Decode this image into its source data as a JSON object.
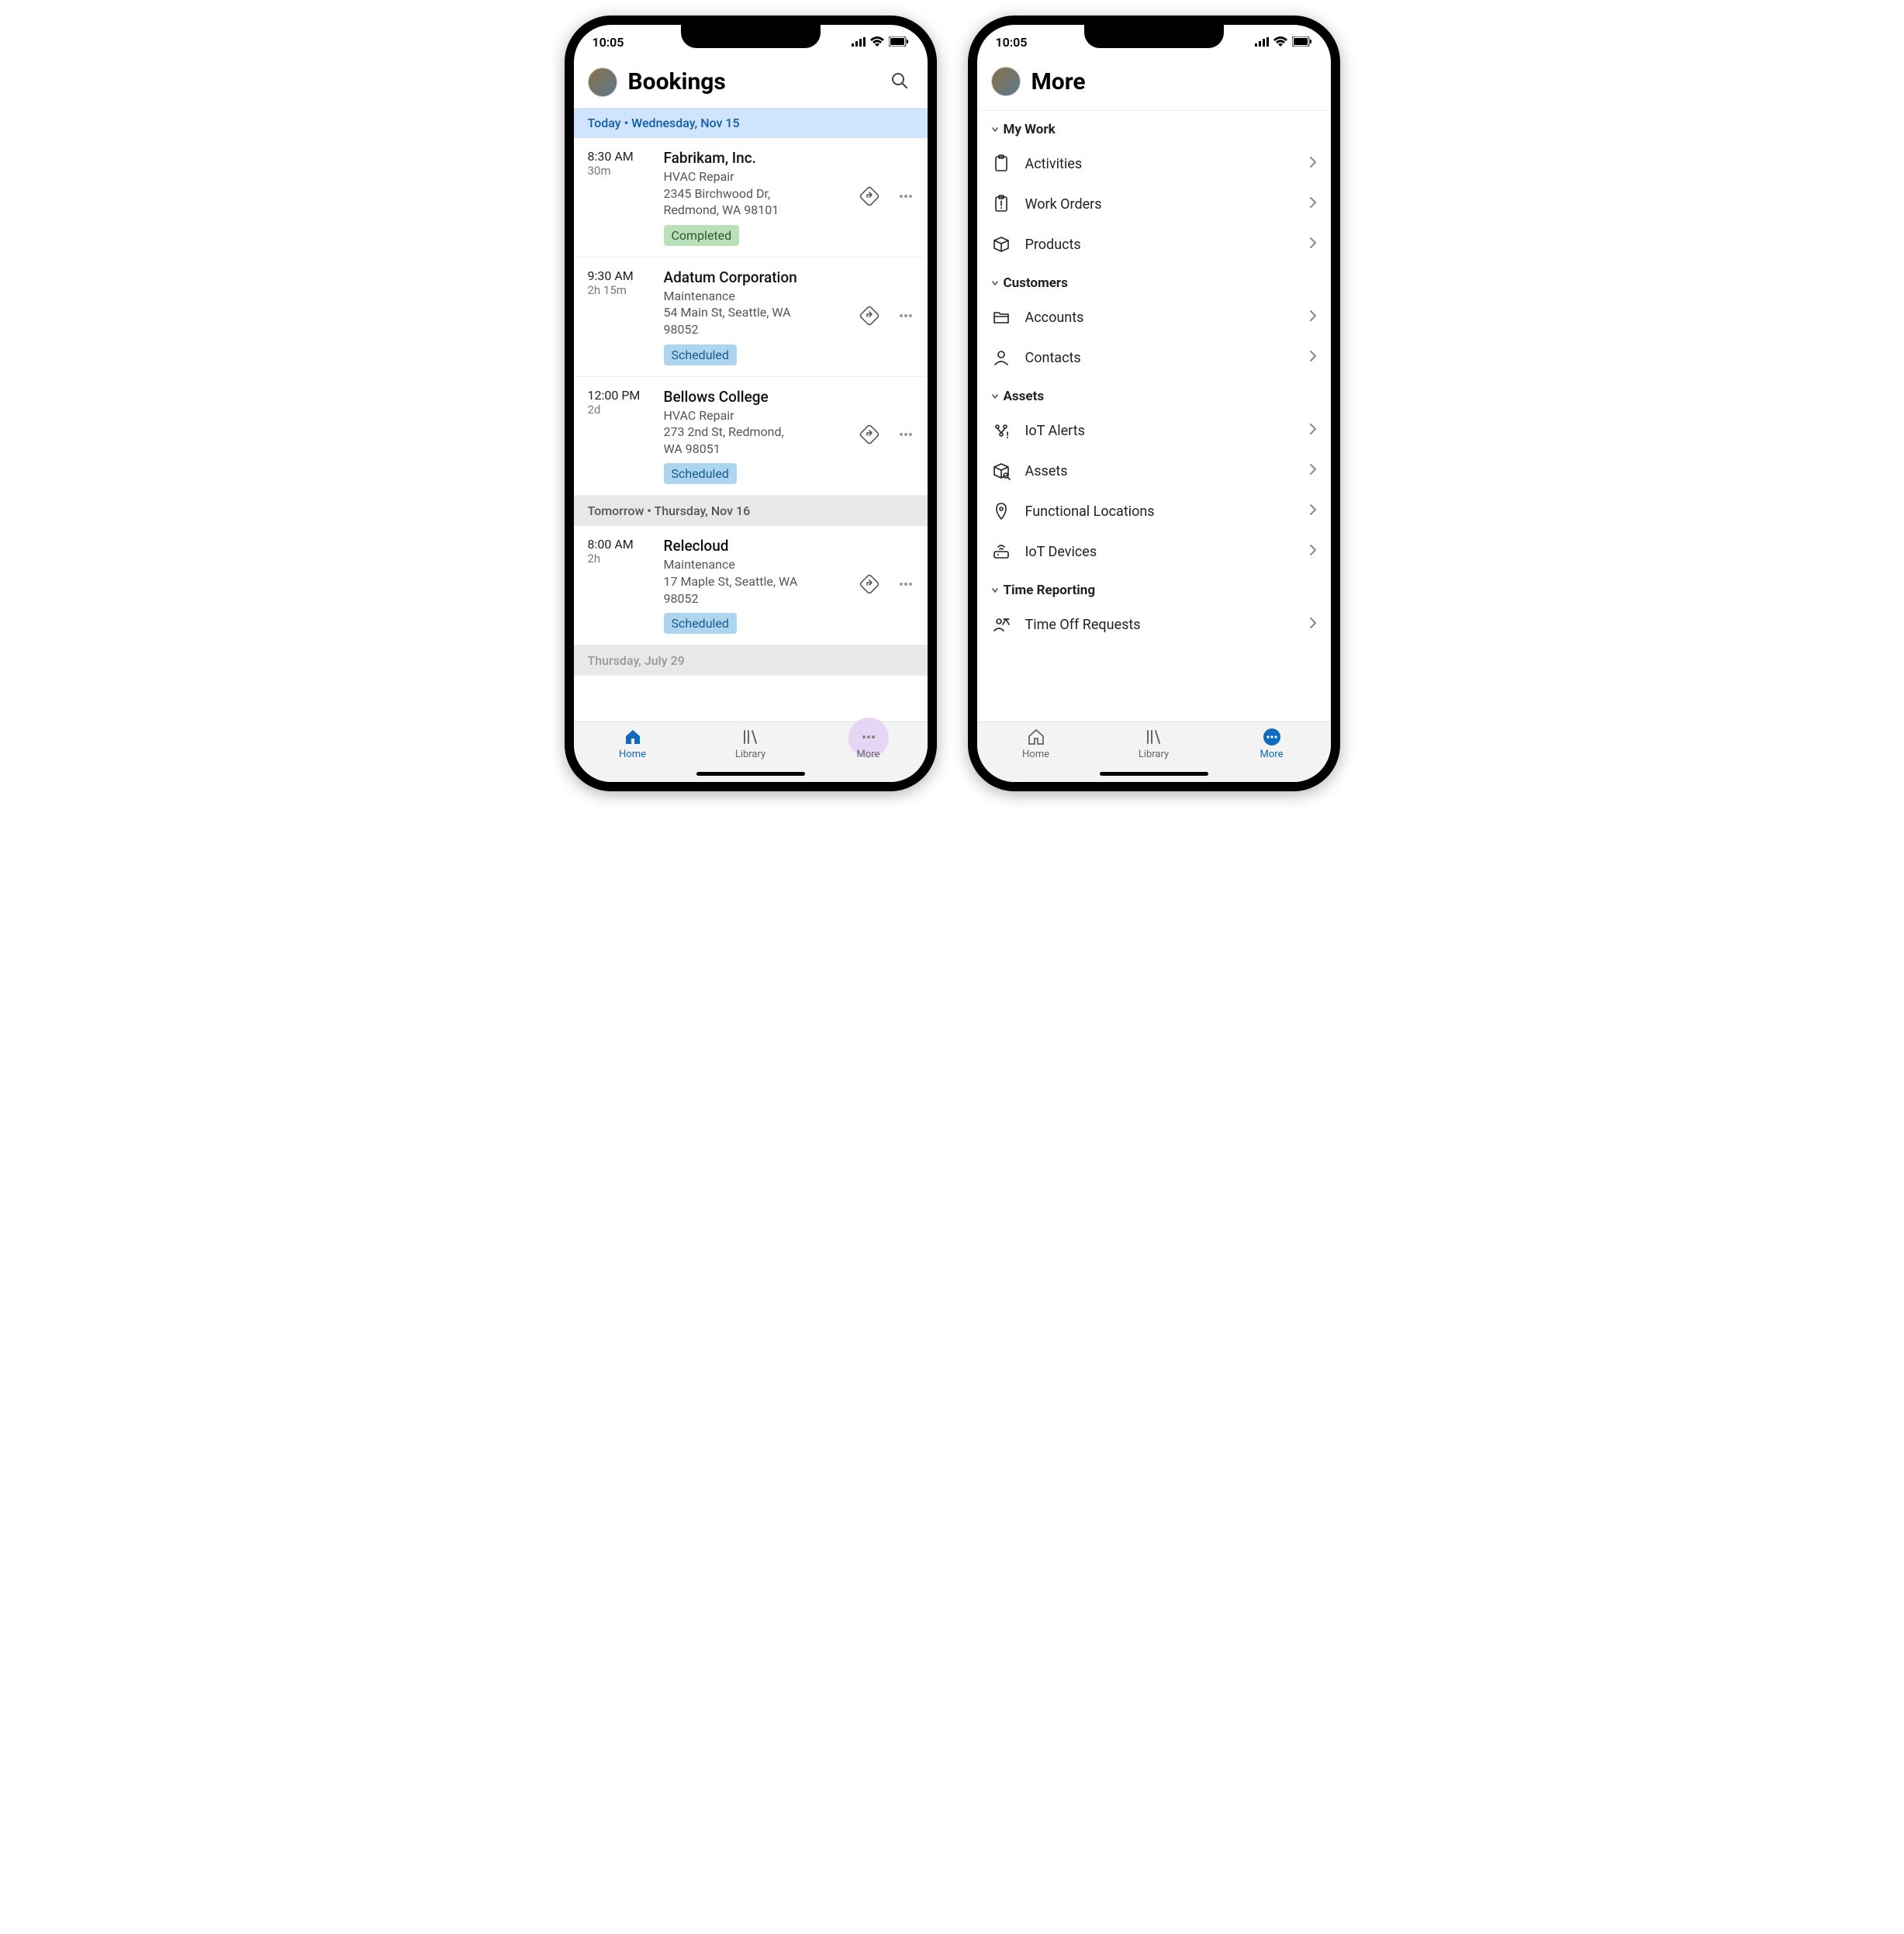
{
  "status": {
    "time": "10:05"
  },
  "left": {
    "title": "Bookings",
    "sections": [
      {
        "label": "Today  •  Wednesday, Nov 15",
        "kind": "today",
        "items": [
          {
            "time": "8:30 AM",
            "duration": "30m",
            "company": "Fabrikam, Inc.",
            "type": "HVAC Repair",
            "addr1": "2345 Birchwood Dr,",
            "addr2": "Redmond, WA 98101",
            "status": "Completed",
            "statusKind": "completed"
          },
          {
            "time": "9:30 AM",
            "duration": "2h 15m",
            "company": "Adatum Corporation",
            "type": "Maintenance",
            "addr1": "54 Main St, Seattle, WA",
            "addr2": "98052",
            "status": "Scheduled",
            "statusKind": "scheduled"
          },
          {
            "time": "12:00 PM",
            "duration": "2d",
            "company": "Bellows College",
            "type": "HVAC Repair",
            "addr1": "273 2nd St, Redmond,",
            "addr2": "WA 98051",
            "status": "Scheduled",
            "statusKind": "scheduled"
          }
        ]
      },
      {
        "label": "Tomorrow  •  Thursday, Nov 16",
        "kind": "tomorrow",
        "items": [
          {
            "time": "8:00 AM",
            "duration": "2h",
            "company": "Relecloud",
            "type": "Maintenance",
            "addr1": "17 Maple St, Seattle, WA",
            "addr2": "98052",
            "status": "Scheduled",
            "statusKind": "scheduled"
          }
        ]
      }
    ],
    "peekDate": "Thursday, July 29",
    "tabs": {
      "home": "Home",
      "library": "Library",
      "more": "More",
      "active": "home"
    }
  },
  "right": {
    "title": "More",
    "groups": [
      {
        "title": "My Work",
        "items": [
          {
            "icon": "clipboard",
            "label": "Activities"
          },
          {
            "icon": "clipboard-alert",
            "label": "Work Orders"
          },
          {
            "icon": "box",
            "label": "Products"
          }
        ]
      },
      {
        "title": "Customers",
        "items": [
          {
            "icon": "folder",
            "label": "Accounts"
          },
          {
            "icon": "person",
            "label": "Contacts"
          }
        ]
      },
      {
        "title": "Assets",
        "items": [
          {
            "icon": "iot-alert",
            "label": "IoT Alerts"
          },
          {
            "icon": "box-search",
            "label": "Assets"
          },
          {
            "icon": "location",
            "label": "Functional Locations"
          },
          {
            "icon": "router",
            "label": "IoT Devices"
          }
        ]
      },
      {
        "title": "Time Reporting",
        "items": [
          {
            "icon": "timeoff",
            "label": "Time Off Requests"
          }
        ]
      }
    ],
    "tabs": {
      "home": "Home",
      "library": "Library",
      "more": "More",
      "active": "more"
    }
  }
}
